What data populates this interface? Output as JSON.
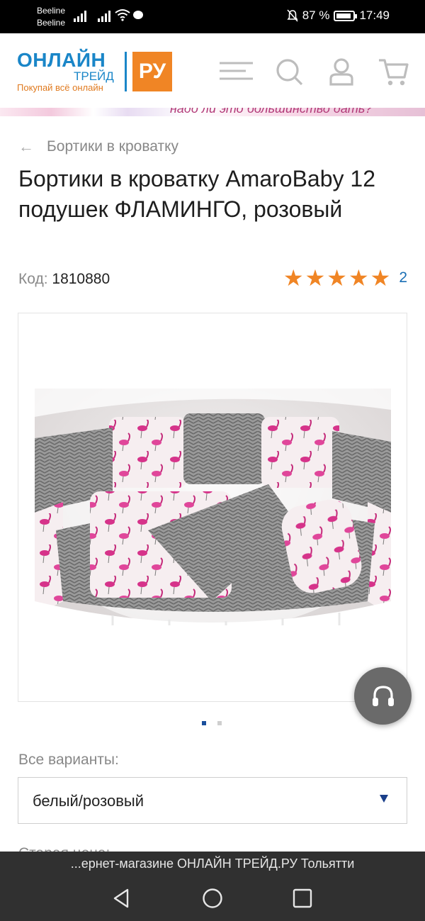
{
  "status_bar": {
    "carrier_1": "Beeline",
    "carrier_2": "Beeline",
    "battery": "87 %",
    "time": "17:49",
    "battery_level": 0.87
  },
  "header": {
    "logo_line1": "ОНЛАЙН",
    "logo_line2": "ТРЕЙД",
    "logo_badge": "РУ",
    "logo_tagline": "Покупай всё онлайн",
    "icons": [
      "menu-icon",
      "search-icon",
      "user-icon",
      "cart-icon"
    ]
  },
  "banner": {
    "text": "надо ли это большинство дать?"
  },
  "breadcrumb": {
    "label": "Бортики в кроватку"
  },
  "product": {
    "title": "Бортики в кроватку AmaroBaby 12 подушек ФЛАМИНГО, розовый",
    "code_label": "Код:",
    "code_value": "1810880",
    "rating_stars": 5,
    "rating_count": "2"
  },
  "gallery": {
    "current_slide": 1,
    "total_slides": 2
  },
  "variants": {
    "label": "Все варианты:",
    "selected": "белый/розовый"
  },
  "cut_off_text": "Старая цена:",
  "browser": {
    "url_text": "...ернет-магазине ОНЛАЙН ТРЕЙД.РУ Тольятти"
  },
  "colors": {
    "accent_orange": "#f08525",
    "brand_blue": "#1a86c8",
    "rating_star": "#f08525",
    "link_blue": "#1a6fb5"
  }
}
